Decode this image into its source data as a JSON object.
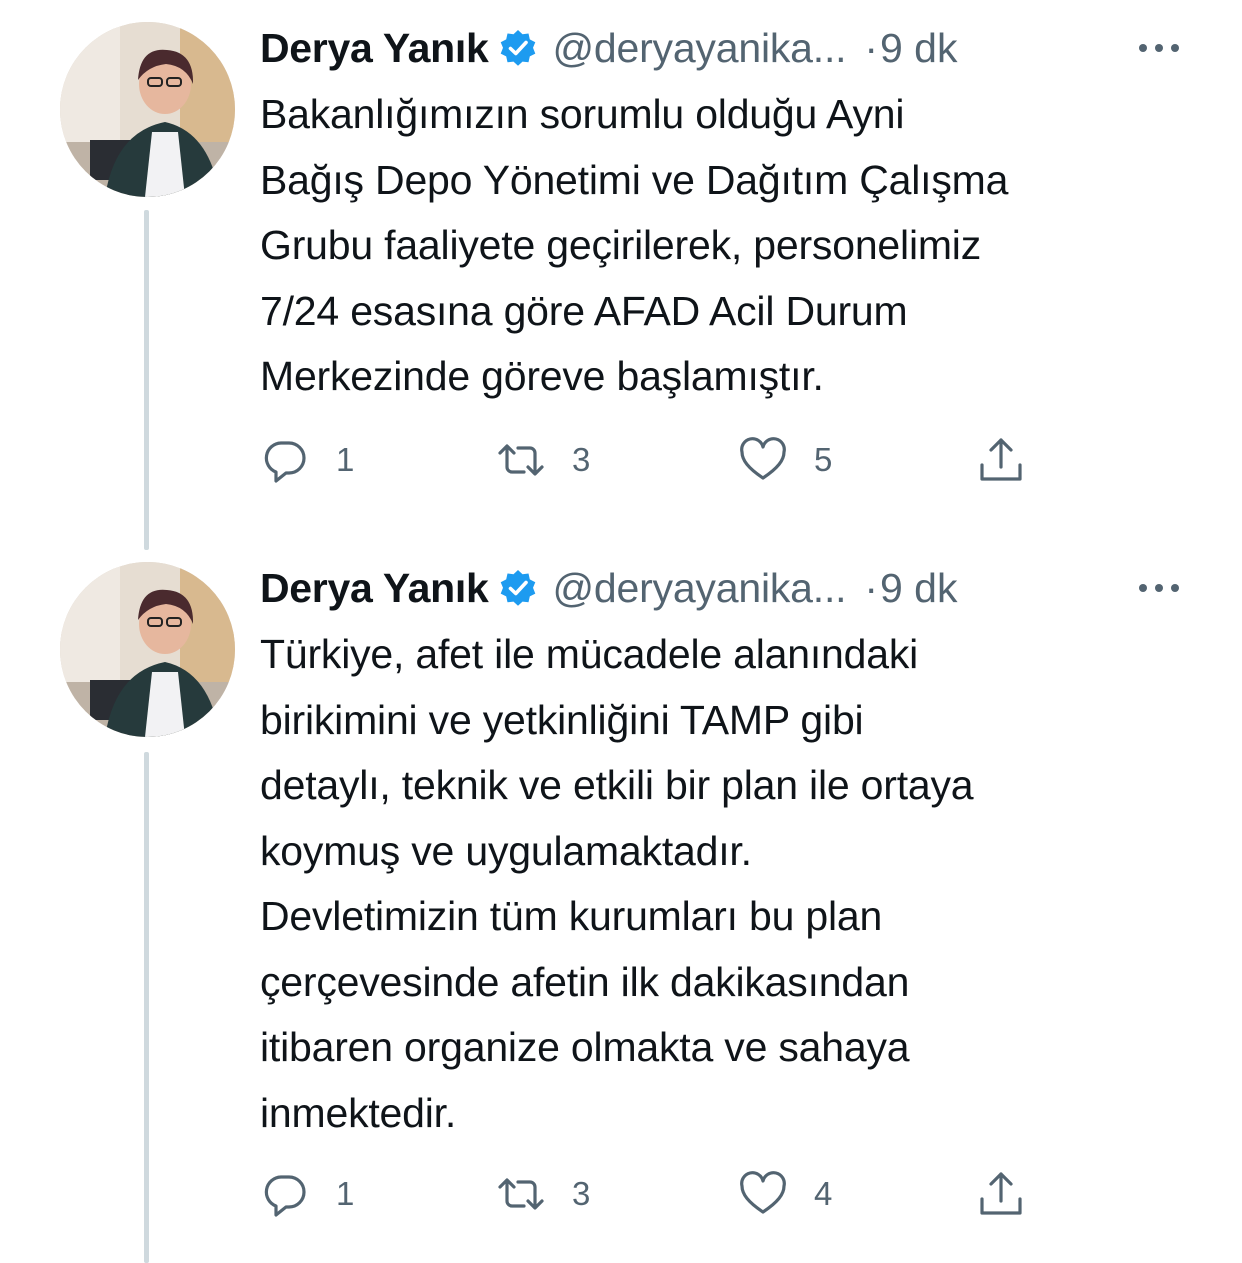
{
  "tweets": [
    {
      "author": "Derya Yanık",
      "handle": "@deryayanika...",
      "separator": "·",
      "time": "9 dk",
      "lines": [
        "Bakanlığımızın sorumlu olduğu Ayni",
        "Bağış Depo Yönetimi ve Dağıtım Çalışma",
        "Grubu faaliyete geçirilerek, personelimiz",
        "7/24 esasına göre AFAD Acil Durum",
        "Merkezinde göreve başlamıştır."
      ],
      "replies": "1",
      "retweets": "3",
      "likes": "5"
    },
    {
      "author": "Derya Yanık",
      "handle": "@deryayanika...",
      "separator": "·",
      "time": "9 dk",
      "lines": [
        "Türkiye, afet ile mücadele alanındaki",
        "birikimini ve yetkinliğini TAMP gibi",
        "detaylı, teknik ve etkili bir plan ile ortaya",
        "koymuş ve uygulamaktadır.",
        "Devletimizin tüm kurumları bu plan",
        "çerçevesinde afetin ilk dakikasından",
        "itibaren organize olmakta ve sahaya",
        "inmektedir."
      ],
      "replies": "1",
      "retweets": "3",
      "likes": "4"
    }
  ],
  "icons": {
    "verified": "verified-badge-icon",
    "more": "more-options-icon",
    "reply": "reply-icon",
    "retweet": "retweet-icon",
    "like": "heart-icon",
    "share": "share-icon"
  },
  "colors": {
    "verified_blue": "#1d9bf0",
    "secondary_text": "#536471",
    "primary_text": "#0f1419",
    "thread_line": "#cfd9de"
  }
}
